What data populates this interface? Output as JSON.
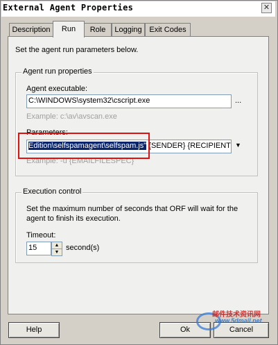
{
  "window": {
    "title": "External Agent Properties"
  },
  "tabs": [
    {
      "label": "Description",
      "active": false
    },
    {
      "label": "Run",
      "active": true
    },
    {
      "label": "Role",
      "active": false
    },
    {
      "label": "Logging",
      "active": false
    },
    {
      "label": "Exit Codes",
      "active": false
    }
  ],
  "intro": "Set the agent run parameters below.",
  "run_group": {
    "title": "Agent run properties",
    "executable_label": "Agent executable:",
    "executable_value": "C:\\WINDOWS\\system32\\cscript.exe",
    "browse_label": "...",
    "executable_example": "Example: c:\\av\\avscan.exe",
    "parameters_label": "Parameters:",
    "parameters_selected": "Edition\\selfspamagent\\selfspam.js\"",
    "parameters_rest": " {SENDER} {RECIPIENTS}",
    "parameters_example": "Example: -u {EMAILFILESPEC}"
  },
  "exec_group": {
    "title": "Execution control",
    "description": "Set the maximum number of seconds that ORF will wait for the agent to finish its execution.",
    "timeout_label": "Timeout:",
    "timeout_value": "15",
    "timeout_unit": "second(s)"
  },
  "buttons": {
    "help": "Help",
    "ok": "Ok",
    "cancel": "Cancel"
  },
  "watermark": {
    "text": "邮件技术资讯网",
    "url": "www.5dmail.net"
  }
}
